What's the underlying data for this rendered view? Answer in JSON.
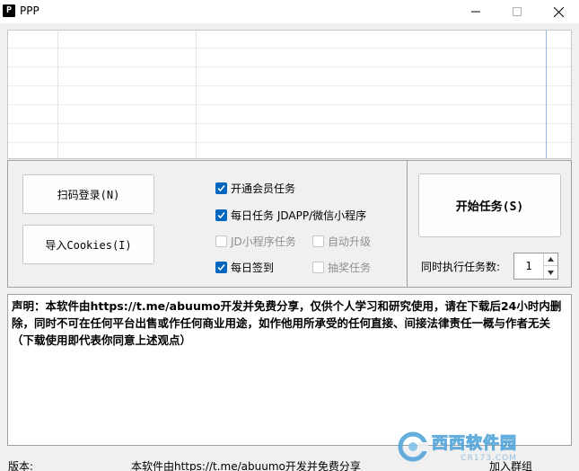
{
  "window": {
    "app_icon_letter": "P",
    "title": "PPP"
  },
  "buttons": {
    "qr_login": "扫码登录(N)",
    "import_cookies": "导入Cookies(I)",
    "start_tasks": "开始任务(S)"
  },
  "checkboxes": [
    {
      "label": "开通会员任务",
      "checked": true,
      "enabled": true
    },
    {
      "label": "每日任务 JDAPP/微信小程序",
      "checked": true,
      "enabled": true
    },
    {
      "label": "JD小程序任务",
      "checked": false,
      "enabled": false
    },
    {
      "label": "自动升级",
      "checked": false,
      "enabled": false
    },
    {
      "label": "每日签到",
      "checked": true,
      "enabled": true
    },
    {
      "label": "抽奖任务",
      "checked": false,
      "enabled": false
    }
  ],
  "concurrency": {
    "label": "同时执行任务数:",
    "value": "1"
  },
  "notice": "声明：本软件由https://t.me/abuumo开发并免费分享，仅供个人学习和研究使用，请在下载后24小时内删除，同时不可在任何平台出售或作任何商业用途，如作他用所承受的任何直接、间接法律责任一概与作者无关（下载使用即代表你同意上述观点）",
  "status": {
    "version_label": "版本:",
    "share_text": "本软件由https://t.me/abuumo开发并免费分享",
    "join_group": "加入群组"
  },
  "watermark": {
    "main": "西西软件园",
    "sub": "CR173.COM"
  },
  "colors": {
    "accent": "#0067c0",
    "watermark": "#4aa0d8"
  }
}
